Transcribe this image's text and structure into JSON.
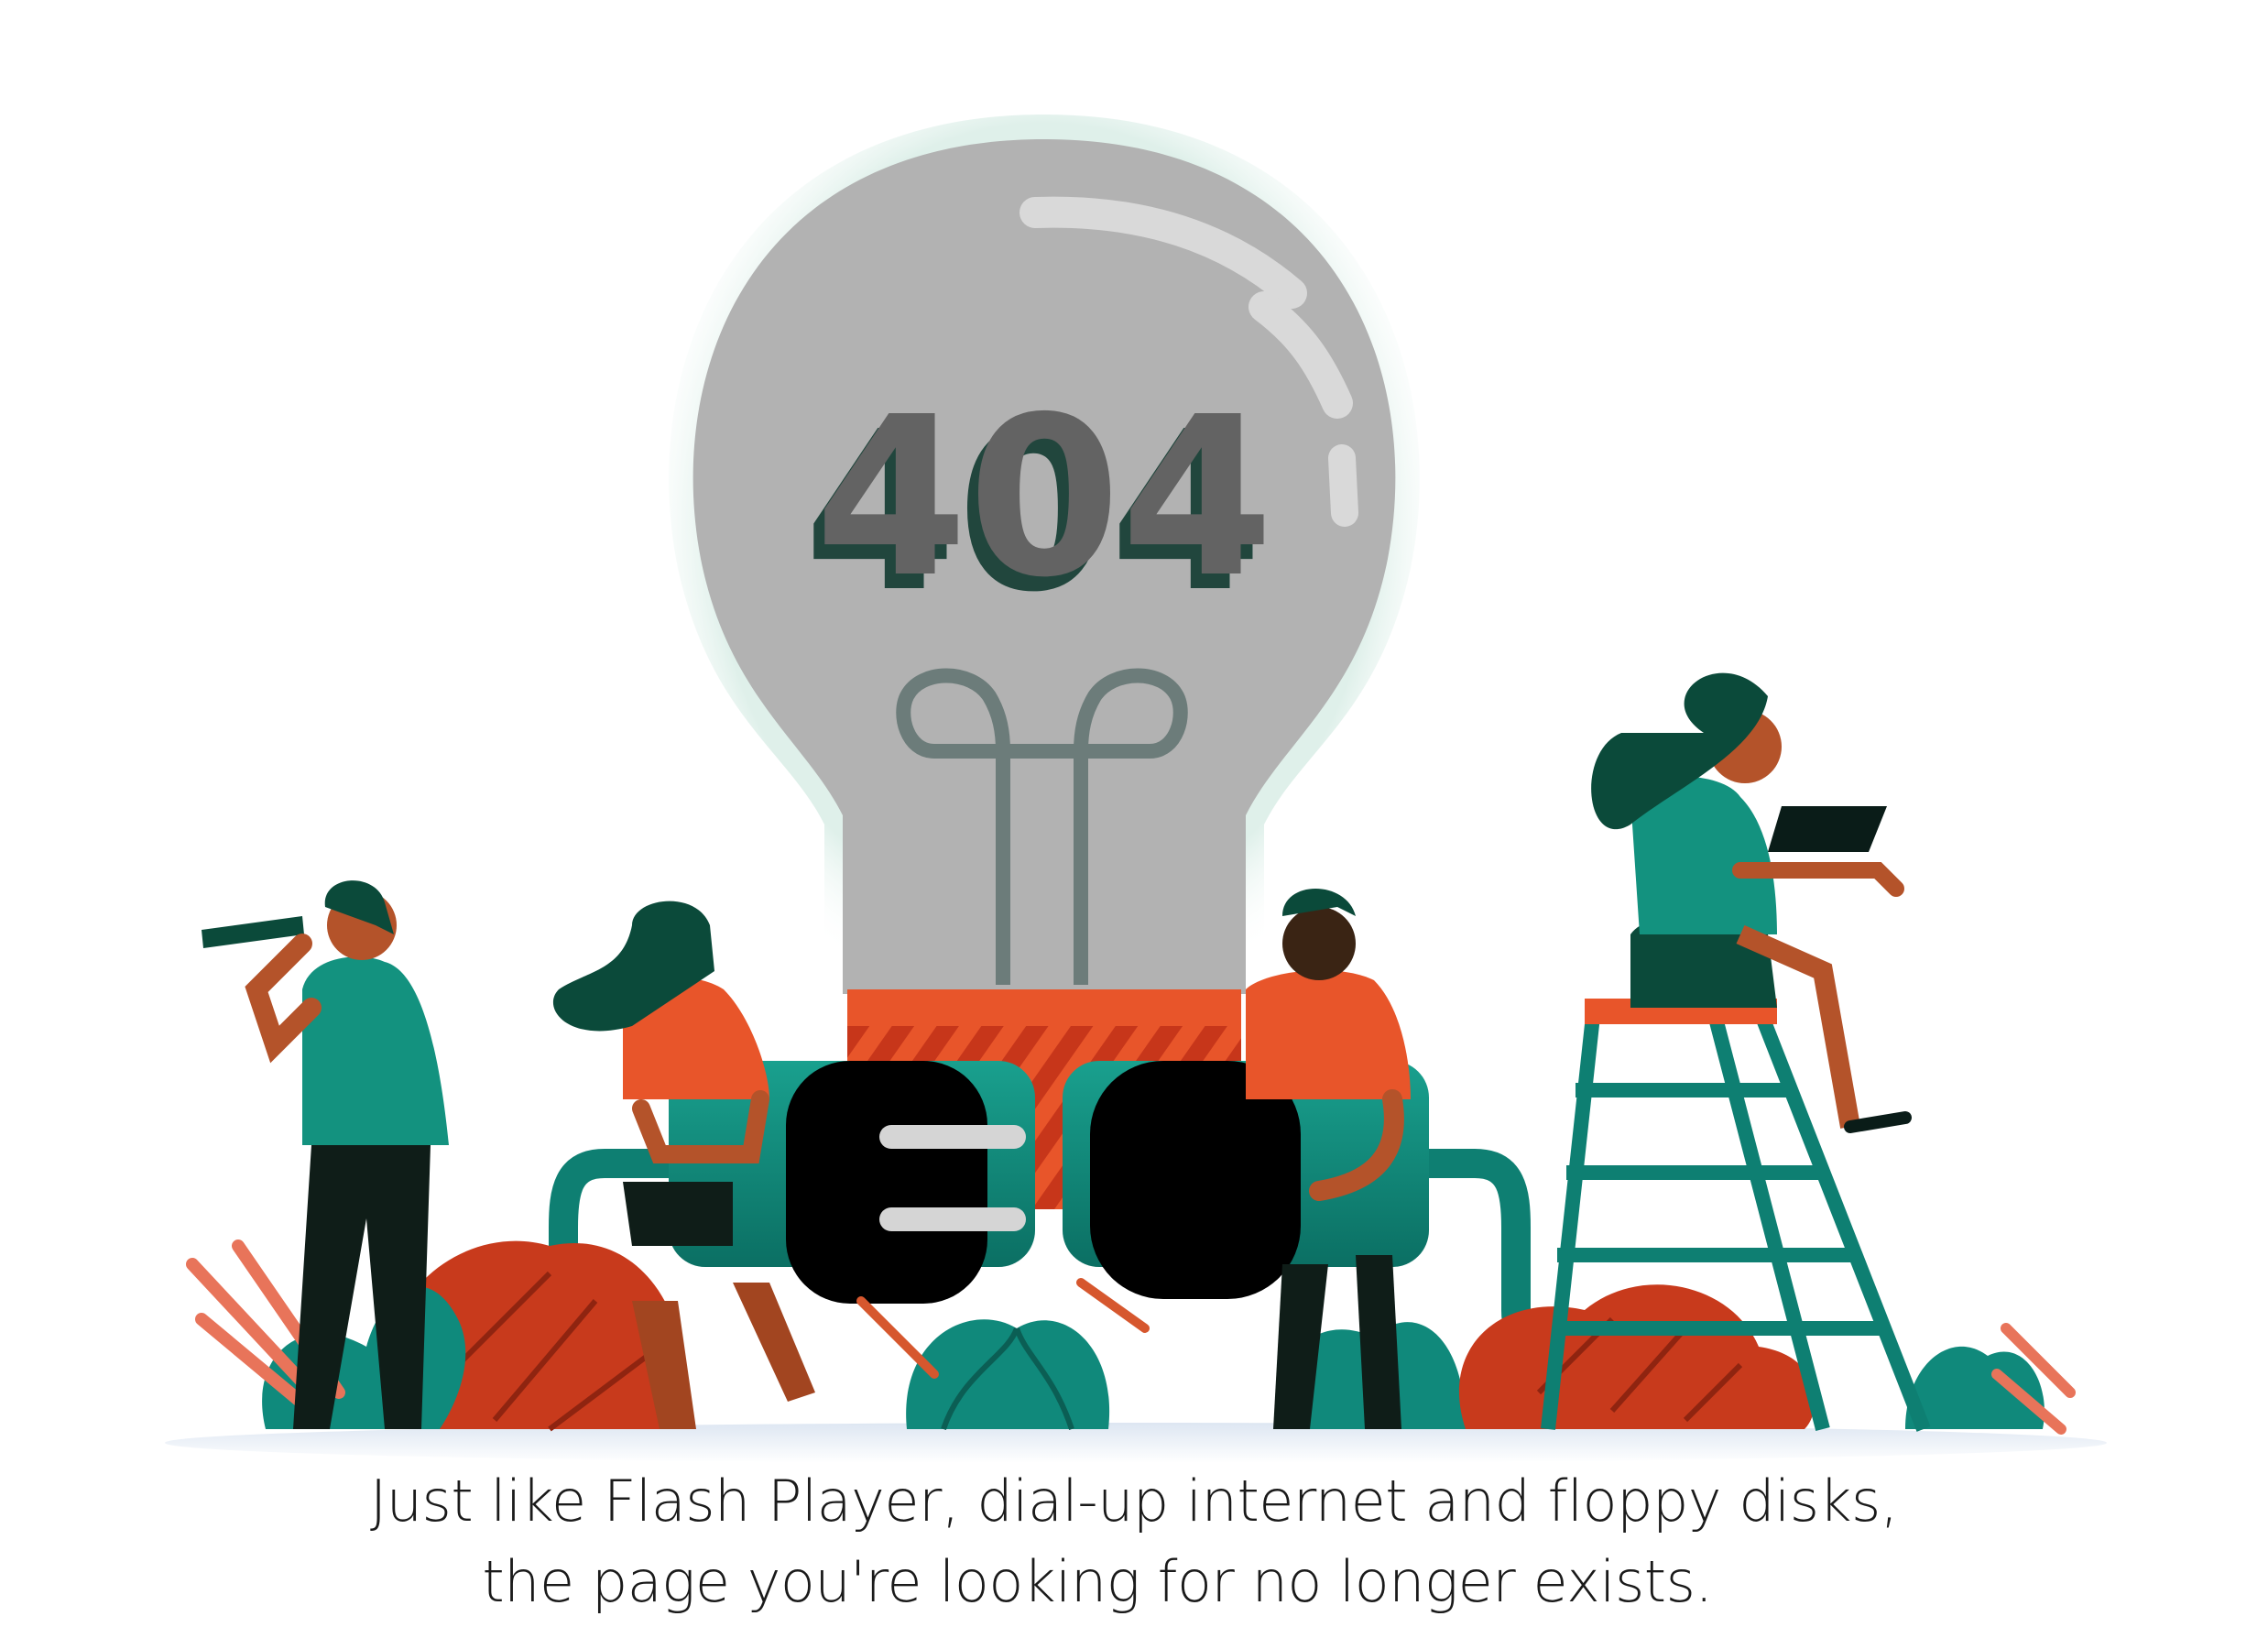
{
  "error": {
    "code": "404"
  },
  "message": {
    "line1": "Just like Flash Player, dial-up internet and floppy disks,",
    "line2": "the page you're looking for no longer exists."
  },
  "colors": {
    "teal": "#0f8a7c",
    "dark_teal": "#0b4a3a",
    "orange": "#e8662e",
    "red": "#c73a1c",
    "bulb_gray": "#b0b0b0",
    "text_gray": "#606060",
    "skin": "#b4532a"
  },
  "icons": {
    "bulb": "lightbulb-icon",
    "plug": "power-plug-icon",
    "socket": "power-socket-icon"
  }
}
